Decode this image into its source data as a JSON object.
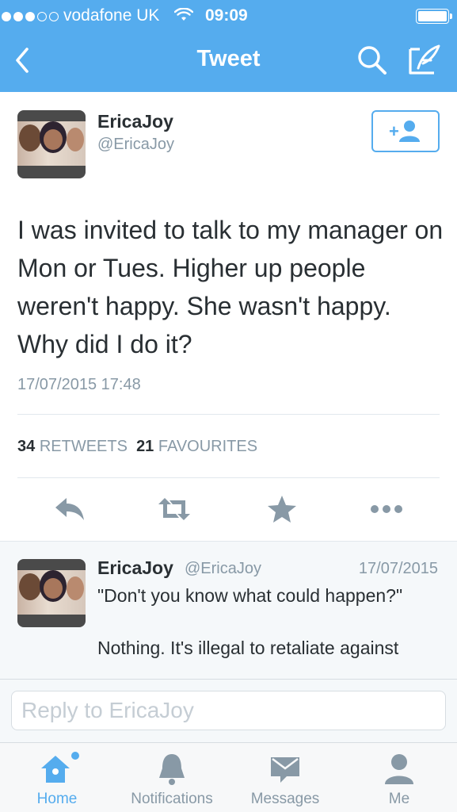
{
  "status_bar": {
    "carrier": "vodafone UK",
    "time": "09:09"
  },
  "nav": {
    "title": "Tweet",
    "back_icon": "chevron-left-icon",
    "search_icon": "search-icon",
    "compose_icon": "compose-icon"
  },
  "tweet": {
    "author_name": "EricaJoy",
    "author_handle": "@EricaJoy",
    "text": "I was invited to talk to my manager on Mon or Tues. Higher up people weren't happy. She wasn't happy. Why did I do it?",
    "timestamp": "17/07/2015 17:48",
    "retweet_count": "34",
    "retweet_label": "RETWEETS",
    "favourite_count": "21",
    "favourite_label": "FAVOURITES"
  },
  "reply": {
    "author_name": "EricaJoy",
    "author_handle": "@EricaJoy",
    "date": "17/07/2015",
    "text": "\"Don't you know what could happen?\"\n\nNothing. It's illegal to retaliate against"
  },
  "compose": {
    "placeholder": "Reply to EricaJoy"
  },
  "tabs": [
    {
      "label": "Home",
      "icon": "home-icon",
      "active": true
    },
    {
      "label": "Notifications",
      "icon": "bell-icon",
      "active": false
    },
    {
      "label": "Messages",
      "icon": "envelope-icon",
      "active": false
    },
    {
      "label": "Me",
      "icon": "person-icon",
      "active": false
    }
  ],
  "colors": {
    "accent": "#55acee",
    "muted": "#8899a6",
    "text": "#292f33"
  }
}
